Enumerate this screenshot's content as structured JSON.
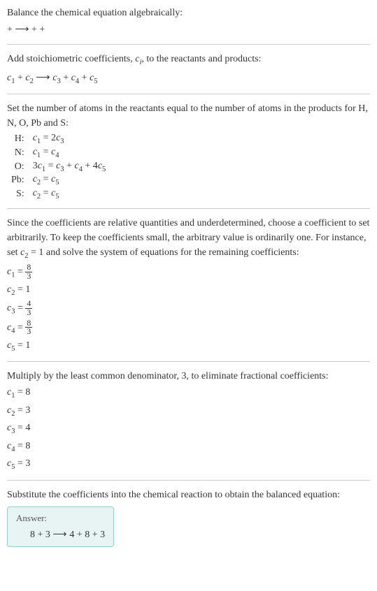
{
  "intro": {
    "line1": "Balance the chemical equation algebraically:",
    "line2_prefix": " + ",
    "line2_arrow": "⟶",
    "line2_suffix": " + + "
  },
  "stoich": {
    "text": "Add stoichiometric coefficients, ",
    "ci": "c",
    "ci_sub": "i",
    "text2": ", to the reactants and products:",
    "eq_left1": "c",
    "eq_left1_sub": "1",
    "plus": " + ",
    "eq_left2": "c",
    "eq_left2_sub": "2",
    "arrow": " ⟶ ",
    "eq_r1": "c",
    "eq_r1_sub": "3",
    "eq_r2": "c",
    "eq_r2_sub": "4",
    "eq_r3": "c",
    "eq_r3_sub": "5"
  },
  "atoms": {
    "text": "Set the number of atoms in the reactants equal to the number of atoms in the products for H, N, O, Pb and S:",
    "rows": [
      {
        "label": "H:",
        "lhs_c": "c",
        "lhs_sub": "1",
        "eq": " = 2",
        "rhs_c": "c",
        "rhs_sub": "3",
        "extra": ""
      },
      {
        "label": "N:",
        "lhs_c": "c",
        "lhs_sub": "1",
        "eq": " = ",
        "rhs_c": "c",
        "rhs_sub": "4",
        "extra": ""
      },
      {
        "label": "O:",
        "lhs_pre": "3",
        "lhs_c": "c",
        "lhs_sub": "1",
        "eq": " = ",
        "rhs_c": "c",
        "rhs_sub": "3",
        "extra1": " + ",
        "rhs_c2": "c",
        "rhs_sub2": "4",
        "extra2": " + 4",
        "rhs_c3": "c",
        "rhs_sub3": "5"
      },
      {
        "label": "Pb:",
        "lhs_c": "c",
        "lhs_sub": "2",
        "eq": " = ",
        "rhs_c": "c",
        "rhs_sub": "5",
        "extra": ""
      },
      {
        "label": "S:",
        "lhs_c": "c",
        "lhs_sub": "2",
        "eq": " = ",
        "rhs_c": "c",
        "rhs_sub": "5",
        "extra": ""
      }
    ]
  },
  "choose": {
    "text": "Since the coefficients are relative quantities and underdetermined, choose a coefficient to set arbitrarily. To keep the coefficients small, the arbitrary value is ordinarily one. For instance, set ",
    "cvar": "c",
    "csub": "2",
    "ceq": " = 1 and solve the system of equations for the remaining coefficients:",
    "c1": {
      "c": "c",
      "sub": "1",
      "eq": " = ",
      "num": "8",
      "den": "3"
    },
    "c2": {
      "c": "c",
      "sub": "2",
      "eq": " = 1"
    },
    "c3": {
      "c": "c",
      "sub": "3",
      "eq": " = ",
      "num": "4",
      "den": "3"
    },
    "c4": {
      "c": "c",
      "sub": "4",
      "eq": " = ",
      "num": "8",
      "den": "3"
    },
    "c5": {
      "c": "c",
      "sub": "5",
      "eq": " = 1"
    }
  },
  "multiply": {
    "text": "Multiply by the least common denominator, 3, to eliminate fractional coefficients:",
    "rows": [
      {
        "c": "c",
        "sub": "1",
        "val": " = 8"
      },
      {
        "c": "c",
        "sub": "2",
        "val": " = 3"
      },
      {
        "c": "c",
        "sub": "3",
        "val": " = 4"
      },
      {
        "c": "c",
        "sub": "4",
        "val": " = 8"
      },
      {
        "c": "c",
        "sub": "5",
        "val": " = 3"
      }
    ]
  },
  "substitute": {
    "text": "Substitute the coefficients into the chemical reaction to obtain the balanced equation:"
  },
  "answer": {
    "label": "Answer:",
    "v1": "8",
    "plus1": " + 3",
    "arrow": " ⟶ ",
    "v2": "4",
    "plus2": " + 8",
    "plus3": " + 3"
  }
}
